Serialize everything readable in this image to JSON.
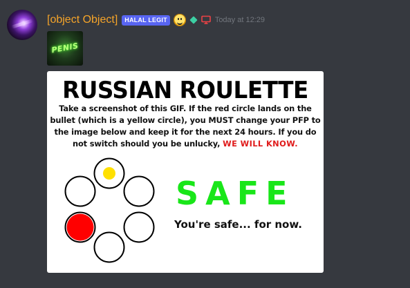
{
  "message": {
    "username": "[object Object]",
    "role_badge": "HALAL LEGIT",
    "timestamp": "Today at 12:29",
    "icons": {
      "avatar": "galaxy-avatar",
      "emoji": "smiley-emoji-icon",
      "boost": "nitro-diamond-icon",
      "platform": "desktop-monitor-icon"
    },
    "thumbnail_text": "PENIS",
    "colors": {
      "username": "#f7a529",
      "badge": "#5865f2",
      "timestamp": "#72767d",
      "platform_icon": "#ed4245"
    }
  },
  "roulette_image": {
    "title": "RUSSIAN ROULETTE",
    "instructions": "Take a screenshot of this GIF. If the red circle lands on the bullet (which is a yellow circle), you MUST change your PFP to the image below and keep it for the next 24 hours. If you do not switch should you be unlucky, ",
    "warning": "WE WILL KNOW.",
    "result": "SAFE",
    "result_subtitle": "You're safe... for now.",
    "chamber": {
      "slots": 6,
      "bullet_color": "#ffe000",
      "selector_color": "#ff0000",
      "result_color": "#19e619"
    }
  }
}
